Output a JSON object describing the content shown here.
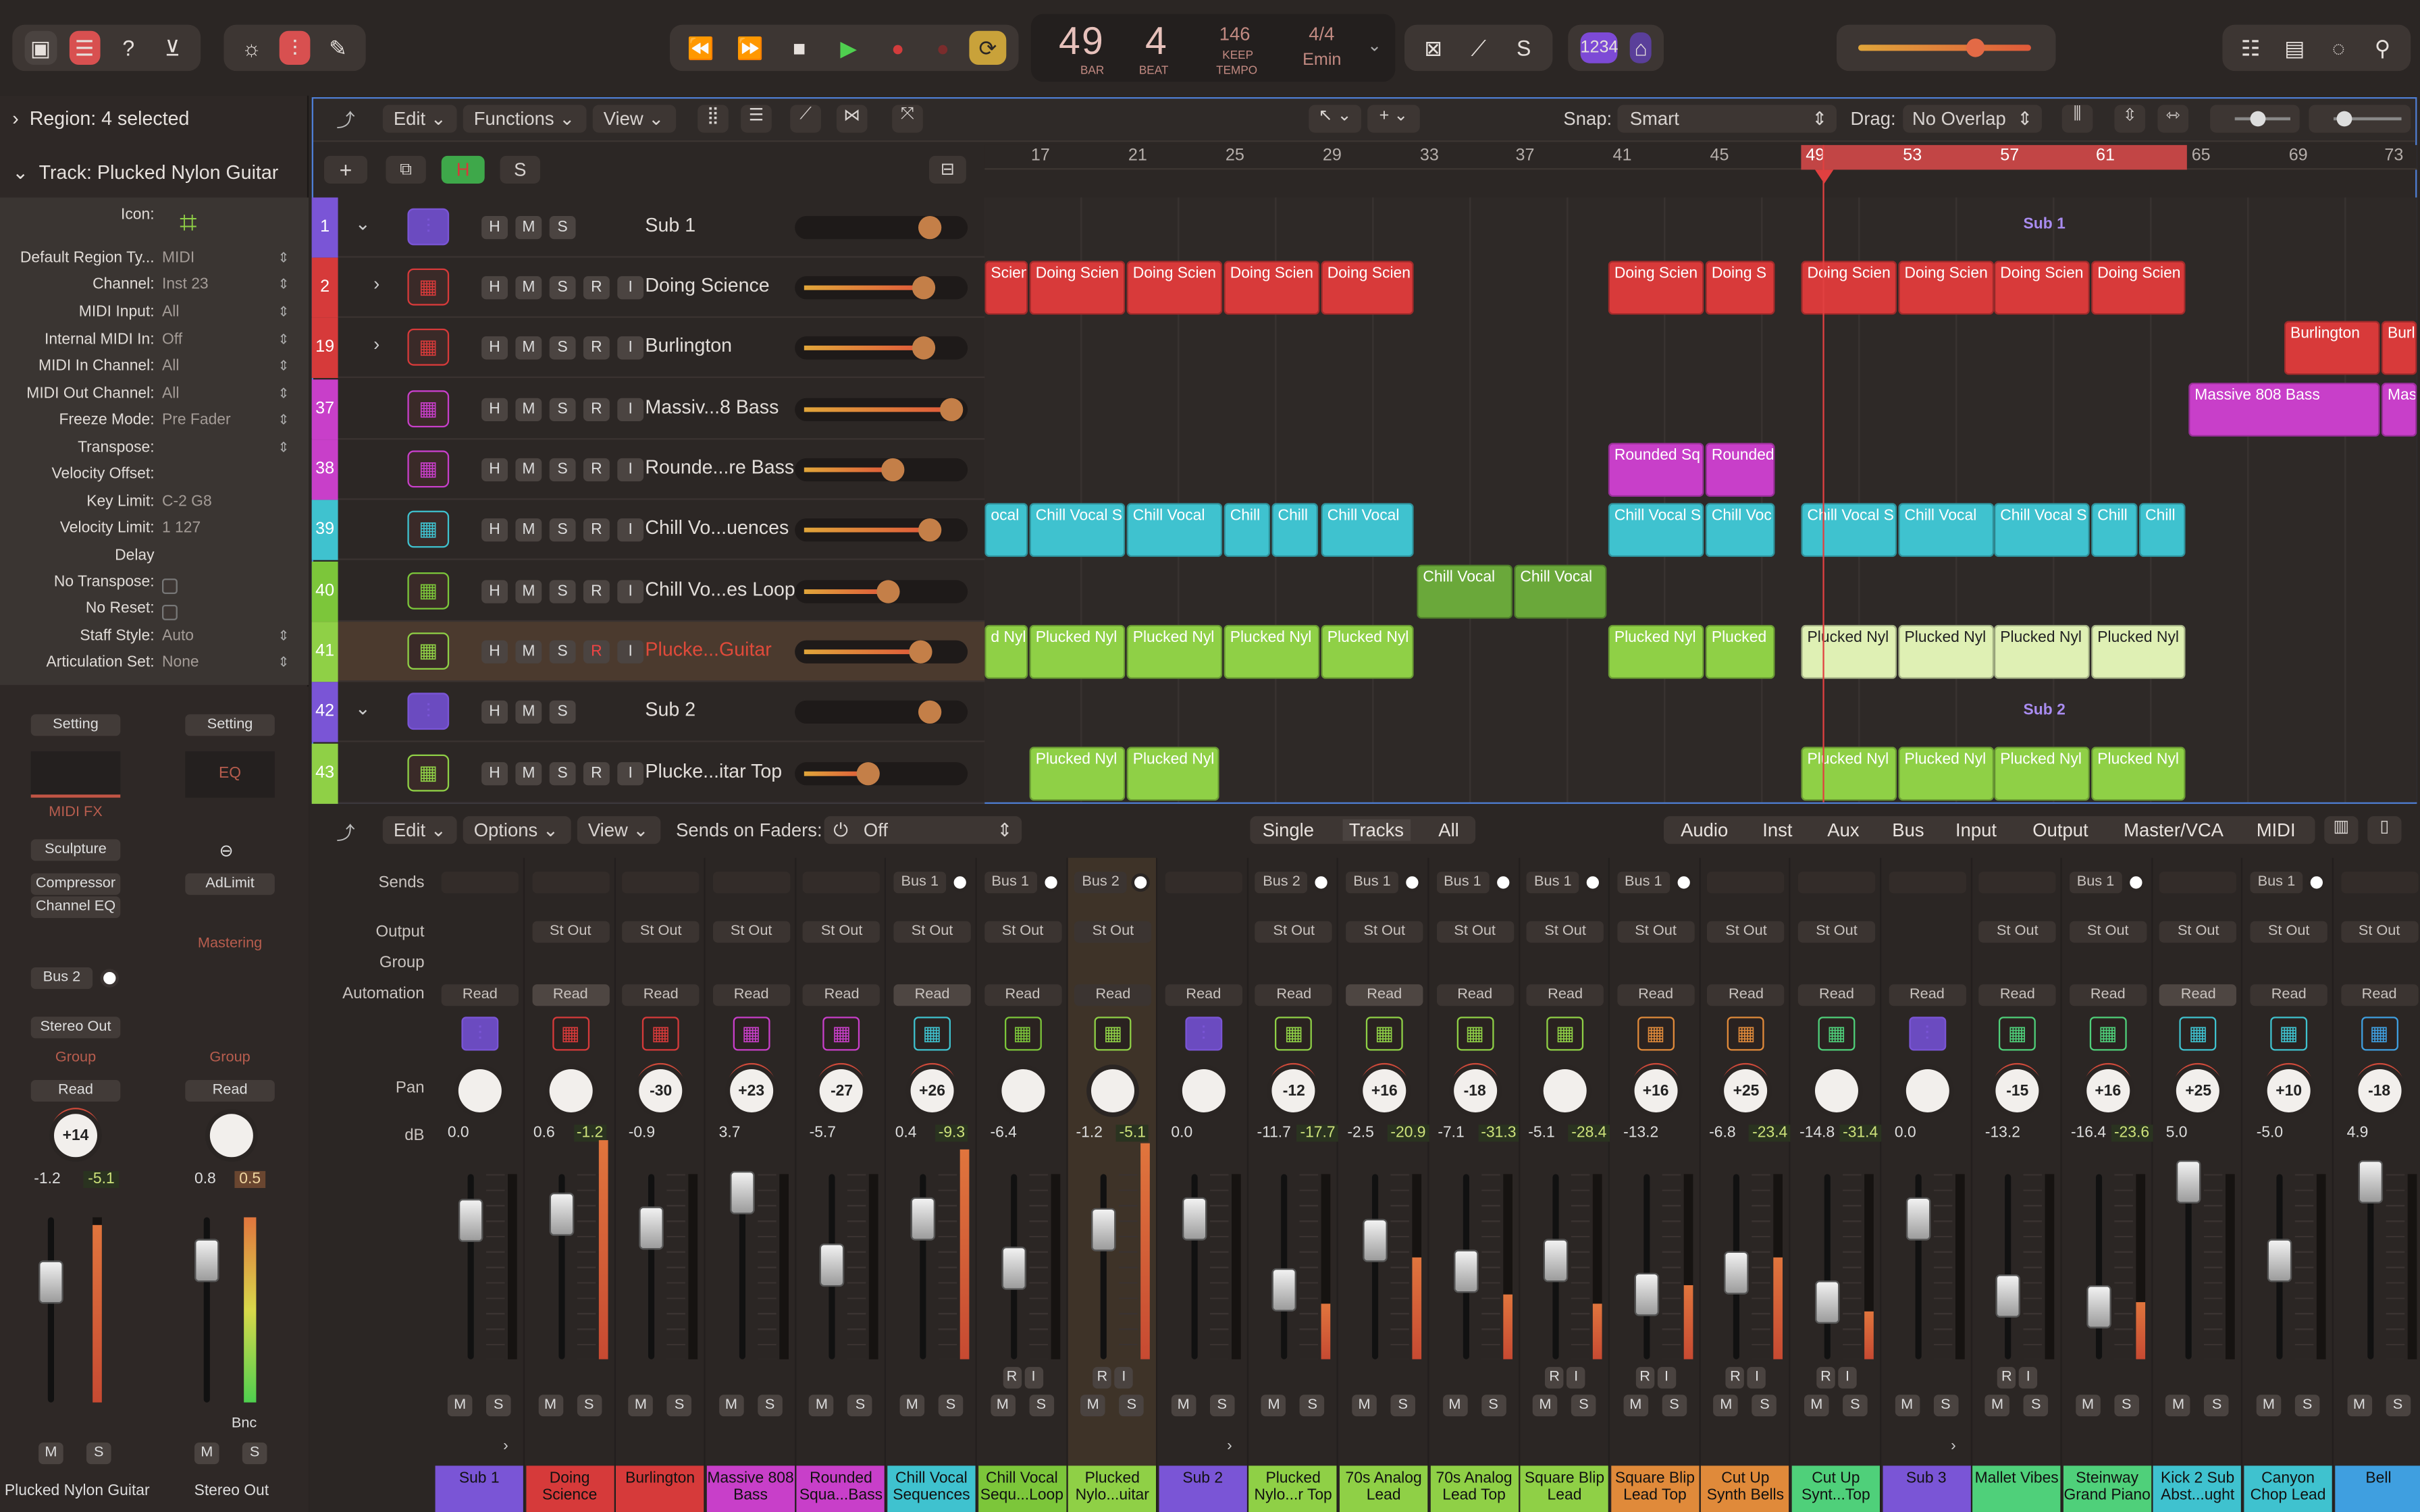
{
  "top": {
    "lcd": {
      "bar": "49",
      "beat": "4",
      "bar_label": "BAR",
      "beat_label": "BEAT",
      "tempo": "146",
      "keep": "KEEP",
      "tempo_label": "TEMPO",
      "sig": "4/4",
      "key": "Emin"
    },
    "badge": "1234"
  },
  "inspector": {
    "region": "Region: 4 selected",
    "track": "Track: Plucked Nylon Guitar",
    "rows": [
      [
        "Icon:",
        ""
      ],
      [
        "Default Region Ty...",
        "MIDI"
      ],
      [
        "Channel:",
        "Inst 23"
      ],
      [
        "MIDI Input:",
        "All"
      ],
      [
        "Internal MIDI In:",
        "Off"
      ],
      [
        "MIDI In Channel:",
        "All"
      ],
      [
        "MIDI Out Channel:",
        "All"
      ],
      [
        "Freeze Mode:",
        "Pre Fader"
      ],
      [
        "Transpose:",
        ""
      ],
      [
        "Velocity Offset:",
        ""
      ],
      [
        "Key Limit:",
        "C-2  G8"
      ],
      [
        "Velocity Limit:",
        "1  127"
      ],
      [
        "Delay",
        ""
      ],
      [
        "No Transpose:",
        ""
      ],
      [
        "No Reset:",
        ""
      ],
      [
        "Staff Style:",
        "Auto"
      ],
      [
        "Articulation Set:",
        "None"
      ]
    ]
  },
  "ch_left": {
    "setting": "Setting",
    "midi_fx": "MIDI FX",
    "plugins": [
      "Sculpture",
      "Compressor",
      "Channel EQ"
    ],
    "send": "Bus 2",
    "output": "Stereo Out",
    "group": "Group",
    "auto": "Read",
    "pan": "+14",
    "db1": "-1.2",
    "db2": "-5.1",
    "name": "Plucked Nylon Guitar"
  },
  "ch_right": {
    "setting": "Setting",
    "eq": "EQ",
    "plugin": "AdLimit",
    "mastering": "Mastering",
    "group": "Group",
    "auto": "Read",
    "db1": "0.8",
    "db2": "0.5",
    "bnc": "Bnc",
    "name": "Stereo Out"
  },
  "ms": {
    "m": "M",
    "s": "S"
  },
  "arrange": {
    "menu": {
      "edit": "Edit",
      "functions": "Functions",
      "view": "View"
    },
    "snap_label": "Snap:",
    "snap": "Smart",
    "drag_label": "Drag:",
    "drag": "No Overlap",
    "h": "H",
    "s": "S",
    "ruler": [
      "17",
      "21",
      "25",
      "29",
      "33",
      "37",
      "41",
      "45",
      "49",
      "53",
      "57",
      "61",
      "65",
      "69",
      "73"
    ],
    "tracks": [
      {
        "num": "1",
        "name": "Sub 1",
        "color": "#7a55d6",
        "stack": true
      },
      {
        "num": "2",
        "name": "Doing Science",
        "color": "#d63a3a",
        "rec": true
      },
      {
        "num": "19",
        "name": "Burlington",
        "color": "#d63a3a",
        "rec": true
      },
      {
        "num": "37",
        "name": "Massiv...8 Bass",
        "color": "#c83fc9",
        "rec": true
      },
      {
        "num": "38",
        "name": "Rounde...re Bass",
        "color": "#c83fc9",
        "rec": true
      },
      {
        "num": "39",
        "name": "Chill Vo...uences",
        "color": "#3fc2cf",
        "rec": true
      },
      {
        "num": "40",
        "name": "Chill Vo...es Loop",
        "color": "#7cc63a",
        "rec": true
      },
      {
        "num": "41",
        "name": "Plucke...Guitar",
        "color": "#8fd046",
        "rec": true
      },
      {
        "num": "42",
        "name": "Sub 2",
        "color": "#7a55d6",
        "stack": true
      },
      {
        "num": "43",
        "name": "Plucke...itar Top",
        "color": "#8fd046",
        "rec": true
      }
    ],
    "sub1": "Sub 1",
    "sub2": "Sub 2",
    "regions": {
      "ds": "Doing Scien",
      "ds_s": "Doing S",
      "burl": "Burlington",
      "burl_s": "Burl",
      "m808": "Massive 808 Bass",
      "m808_s": "Mas",
      "rsq": "Rounded Sq",
      "rsq2": "Rounded",
      "cv": "Chill Vocal",
      "cv_s": "Chill Vocal S",
      "cv_v": "Chill Voc",
      "cv_c": "Chill",
      "pn": "Plucked Nyl",
      "pn_s": "Plucked",
      "pn_e": "d Nyl",
      "cv_e": "ocal",
      "ds_e": "Scien"
    }
  },
  "mixer": {
    "menu": {
      "edit": "Edit",
      "options": "Options",
      "view": "View"
    },
    "sends_on_faders": "Sends on Faders:",
    "off": "Off",
    "modes": [
      "Single",
      "Tracks",
      "All"
    ],
    "filters": [
      "Audio",
      "Inst",
      "Aux",
      "Bus",
      "Input",
      "Output",
      "Master/VCA",
      "MIDI"
    ],
    "row_labels": [
      "Sends",
      "Output",
      "Group",
      "Automation",
      "Pan",
      "dB"
    ],
    "strips": [
      {
        "name": "Sub 1",
        "color": "#7a55d6",
        "send": "",
        "out": "",
        "auto": "Read",
        "pan": "",
        "db": "0.0",
        "db2": ""
      },
      {
        "name": "Doing Science",
        "color": "#d63a3a",
        "send": "",
        "out": "St Out",
        "auto": "Read",
        "pan": "",
        "db": "0.6",
        "db2": "-1.2"
      },
      {
        "name": "Burlington",
        "color": "#d63a3a",
        "send": "",
        "out": "St Out",
        "auto": "Read",
        "pan": "-30",
        "db": "-0.9",
        "db2": ""
      },
      {
        "name": "Massive 808 Bass",
        "color": "#c83fc9",
        "send": "",
        "out": "St Out",
        "auto": "Read",
        "pan": "+23",
        "db": "3.7",
        "db2": ""
      },
      {
        "name": "Rounded Squa...Bass",
        "color": "#c83fc9",
        "send": "",
        "out": "St Out",
        "auto": "Read",
        "pan": "-27",
        "db": "-5.7",
        "db2": ""
      },
      {
        "name": "Chill Vocal Sequences",
        "color": "#3fc2cf",
        "send": "Bus 1",
        "out": "St Out",
        "auto": "Read",
        "pan": "+26",
        "db": "0.4",
        "db2": "-9.3"
      },
      {
        "name": "Chill Vocal Sequ...Loop",
        "color": "#7cc63a",
        "send": "Bus 1",
        "out": "St Out",
        "auto": "Read",
        "pan": "",
        "db": "-6.4",
        "db2": ""
      },
      {
        "name": "Plucked Nylo...uitar",
        "color": "#8fd046",
        "send": "Bus 2",
        "out": "St Out",
        "auto": "Read",
        "pan": "",
        "db": "-1.2",
        "db2": "-5.1"
      },
      {
        "name": "Sub 2",
        "color": "#7a55d6",
        "send": "",
        "out": "",
        "auto": "Read",
        "pan": "",
        "db": "0.0",
        "db2": ""
      },
      {
        "name": "Plucked Nylo...r Top",
        "color": "#8fd046",
        "send": "Bus 2",
        "out": "St Out",
        "auto": "Read",
        "pan": "-12",
        "db": "-11.7",
        "db2": "-17.7"
      },
      {
        "name": "70s Analog Lead",
        "color": "#8fd046",
        "send": "Bus 1",
        "out": "St Out",
        "auto": "Read",
        "pan": "+16",
        "db": "-2.5",
        "db2": "-20.9"
      },
      {
        "name": "70s Analog Lead Top",
        "color": "#8fd046",
        "send": "Bus 1",
        "out": "St Out",
        "auto": "Read",
        "pan": "-18",
        "db": "-7.1",
        "db2": "-31.3"
      },
      {
        "name": "Square Blip Lead",
        "color": "#8fd046",
        "send": "Bus 1",
        "out": "St Out",
        "auto": "Read",
        "pan": "",
        "db": "-5.1",
        "db2": "-28.4"
      },
      {
        "name": "Square Blip Lead Top",
        "color": "#e08a3a",
        "send": "Bus 1",
        "out": "St Out",
        "auto": "Read",
        "pan": "+16",
        "db": "-13.2",
        "db2": ""
      },
      {
        "name": "Cut Up Synth Bells",
        "color": "#e08a3a",
        "send": "",
        "out": "St Out",
        "auto": "Read",
        "pan": "+25",
        "db": "-6.8",
        "db2": "-23.4"
      },
      {
        "name": "Cut Up Synt...Top",
        "color": "#4fd07a",
        "send": "",
        "out": "St Out",
        "auto": "Read",
        "pan": "",
        "db": "-14.8",
        "db2": "-31.4"
      },
      {
        "name": "Sub 3",
        "color": "#7a55d6",
        "send": "",
        "out": "",
        "auto": "Read",
        "pan": "",
        "db": "0.0",
        "db2": ""
      },
      {
        "name": "Mallet Vibes",
        "color": "#4fd07a",
        "send": "",
        "out": "St Out",
        "auto": "Read",
        "pan": "-15",
        "db": "-13.2",
        "db2": ""
      },
      {
        "name": "Steinway Grand Piano",
        "color": "#4fd07a",
        "send": "Bus 1",
        "out": "St Out",
        "auto": "Read",
        "pan": "+16",
        "db": "-16.4",
        "db2": "-23.6"
      },
      {
        "name": "Kick 2 Sub Abst...ught",
        "color": "#3fc2cf",
        "send": "",
        "out": "St Out",
        "auto": "Read",
        "pan": "+25",
        "db": "5.0",
        "db2": ""
      },
      {
        "name": "Canyon Chop Lead",
        "color": "#3fc2cf",
        "send": "Bus 1",
        "out": "St Out",
        "auto": "Read",
        "pan": "+10",
        "db": "-5.0",
        "db2": ""
      },
      {
        "name": "Bell",
        "color": "#3f9fe0",
        "send": "",
        "out": "St Out",
        "auto": "Read",
        "pan": "-18",
        "db": "4.9",
        "db2": ""
      }
    ]
  }
}
